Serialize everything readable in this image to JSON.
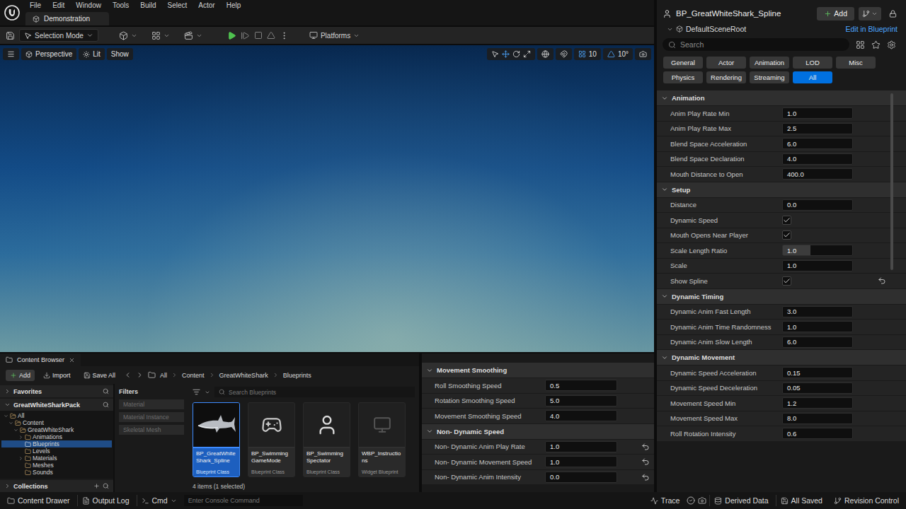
{
  "menu_bar": {
    "menus": [
      "File",
      "Edit",
      "Window",
      "Tools",
      "Build",
      "Select",
      "Actor",
      "Help"
    ],
    "level_tab": "Demonstration"
  },
  "toolbar": {
    "mode": "Selection Mode",
    "platforms": "Platforms"
  },
  "viewport": {
    "view_mode": "Perspective",
    "lighting": "Lit",
    "show": "Show",
    "grid_snap": "10",
    "rotation_snap": "10°"
  },
  "details": {
    "title": "BP_GreatWhiteShark_Spline",
    "add_button": "Add",
    "component": "DefaultSceneRoot",
    "edit_link": "Edit in Blueprint",
    "search": {
      "placeholder": "Search"
    },
    "filters": [
      {
        "label": "General",
        "selected": false
      },
      {
        "label": "Actor",
        "selected": false
      },
      {
        "label": "Animation",
        "selected": false
      },
      {
        "label": "LOD",
        "selected": false
      },
      {
        "label": "Misc",
        "selected": false
      },
      {
        "label": "Physics",
        "selected": false
      },
      {
        "label": "Rendering",
        "selected": false
      },
      {
        "label": "Streaming",
        "selected": false
      },
      {
        "label": "All",
        "selected": true
      }
    ],
    "sections": [
      {
        "title": "Animation",
        "expanded": true,
        "rows": [
          {
            "label": "Anim Play Rate Min",
            "kind": "number",
            "value": "1.0",
            "resettable": false
          },
          {
            "label": "Anim Play Rate Max",
            "kind": "number",
            "value": "2.5",
            "resettable": false
          },
          {
            "label": "Blend Space Acceleration",
            "kind": "number",
            "value": "6.0",
            "resettable": false
          },
          {
            "label": "Blend Space Declaration",
            "kind": "number",
            "value": "4.0",
            "resettable": false
          },
          {
            "label": "Mouth Distance to Open",
            "kind": "number",
            "value": "400.0",
            "resettable": false
          }
        ]
      },
      {
        "title": "Setup",
        "expanded": true,
        "rows": [
          {
            "label": "Distance",
            "kind": "number",
            "value": "0.0",
            "resettable": false
          },
          {
            "label": "Dynamic Speed",
            "kind": "checkbox",
            "checked": true,
            "resettable": false
          },
          {
            "label": "Mouth Opens Near Player",
            "kind": "checkbox",
            "checked": true,
            "resettable": false
          },
          {
            "label": "Scale Length Ratio",
            "kind": "slider",
            "value": "1.0",
            "level": 0.4,
            "resettable": false
          },
          {
            "label": "Scale",
            "kind": "number",
            "value": "1.0",
            "resettable": false
          },
          {
            "label": "Show Spline",
            "kind": "checkbox",
            "checked": true,
            "resettable": true
          }
        ]
      },
      {
        "title": "Dynamic Timing",
        "expanded": true,
        "rows": [
          {
            "label": "Dynamic Anim Fast Length",
            "kind": "number",
            "value": "3.0",
            "resettable": false
          },
          {
            "label": "Dynamic Anim Time Randomness",
            "kind": "number",
            "value": "1.0",
            "resettable": false
          },
          {
            "label": "Dynamic Anim Slow Length",
            "kind": "number",
            "value": "6.0",
            "resettable": false
          }
        ]
      },
      {
        "title": "Dynamic Movement",
        "expanded": true,
        "rows": [
          {
            "label": "Dynamic Speed Acceleration",
            "kind": "number",
            "value": "0.15",
            "resettable": false
          },
          {
            "label": "Dynamic Speed Deceleration",
            "kind": "number",
            "value": "0.05",
            "resettable": false
          },
          {
            "label": "Movement Speed Min",
            "kind": "number",
            "value": "1.2",
            "resettable": false
          },
          {
            "label": "Movement Speed Max",
            "kind": "number",
            "value": "8.0",
            "resettable": false
          },
          {
            "label": "Roll Rotation Intensity",
            "kind": "number",
            "value": "0.6",
            "resettable": false
          }
        ]
      }
    ]
  },
  "movement_panel": {
    "sections": [
      {
        "title": "Movement Smoothing",
        "expanded": true,
        "rows": [
          {
            "label": "Roll Smoothing Speed",
            "kind": "number",
            "value": "0.5",
            "resettable": false
          },
          {
            "label": "Rotation Smoothing Speed",
            "kind": "number",
            "value": "5.0",
            "resettable": false
          },
          {
            "label": "Movement Smoothing Speed",
            "kind": "number",
            "value": "4.0",
            "resettable": false
          }
        ]
      },
      {
        "title": "Non- Dynamic Speed",
        "expanded": true,
        "rows": [
          {
            "label": "Non- Dynamic Anim Play Rate",
            "kind": "number",
            "value": "1.0",
            "resettable": true
          },
          {
            "label": "Non- Dynamic Movement Speed",
            "kind": "number",
            "value": "1.0",
            "resettable": true
          },
          {
            "label": "Non- Dynamic Anim Intensity",
            "kind": "number",
            "value": "0.0",
            "resettable": true
          }
        ]
      }
    ]
  },
  "content_browser": {
    "tab": "Content Browser",
    "add_button": "Add",
    "import_button": "Import",
    "save_all_button": "Save All",
    "breadcrumbs": [
      "All",
      "Content",
      "GreatWhiteShark",
      "Blueprints"
    ],
    "favorites": {
      "label": "Favorites",
      "expanded": false
    },
    "pack": {
      "label": "GreatWhiteSharkPack",
      "expanded": true
    },
    "tree": [
      {
        "label": "All",
        "expandable": true,
        "expanded": true,
        "selected": false,
        "children": [
          {
            "label": "Content",
            "expandable": true,
            "expanded": true,
            "selected": false,
            "children": [
              {
                "label": "GreatWhiteShark",
                "expandable": true,
                "expanded": true,
                "selected": false,
                "children": [
                  {
                    "label": "Animations",
                    "expandable": true,
                    "expanded": false,
                    "selected": false
                  },
                  {
                    "label": "Blueprints",
                    "expandable": false,
                    "expanded": false,
                    "selected": true
                  },
                  {
                    "label": "Levels",
                    "expandable": false,
                    "expanded": false,
                    "selected": false
                  },
                  {
                    "label": "Materials",
                    "expandable": true,
                    "expanded": false,
                    "selected": false
                  },
                  {
                    "label": "Meshes",
                    "expandable": false,
                    "expanded": false,
                    "selected": false
                  },
                  {
                    "label": "Sounds",
                    "expandable": false,
                    "expanded": false,
                    "selected": false
                  }
                ]
              }
            ]
          }
        ]
      }
    ],
    "collections": {
      "label": "Collections",
      "expanded": false
    },
    "filters": {
      "title": "Filters",
      "items": [
        "Material",
        "Material Instance",
        "Skeletal Mesh"
      ]
    },
    "search": {
      "placeholder": "Search Blueprints"
    },
    "assets": [
      {
        "name": "BP_GreatWhiteShark_Spline",
        "type": "Blueprint Class",
        "kind": "shark",
        "selected": true
      },
      {
        "name": "BP_Swimming GameMode",
        "type": "Blueprint Class",
        "kind": "gamemode",
        "selected": false
      },
      {
        "name": "BP_Swimming Spectator",
        "type": "Blueprint Class",
        "kind": "spectator",
        "selected": false
      },
      {
        "name": "WBP_Instructions",
        "type": "Widget Blueprint",
        "kind": "widget",
        "selected": false
      }
    ],
    "item_count": "4 items (1 selected)"
  },
  "status_bar": {
    "content_drawer": "Content Drawer",
    "output_log": "Output Log",
    "cmd": "Cmd",
    "console": {
      "placeholder": "Enter Console Command"
    },
    "trace": "Trace",
    "derived_data": "Derived Data",
    "save_state": "All Saved",
    "revision_control": "Revision Control"
  }
}
